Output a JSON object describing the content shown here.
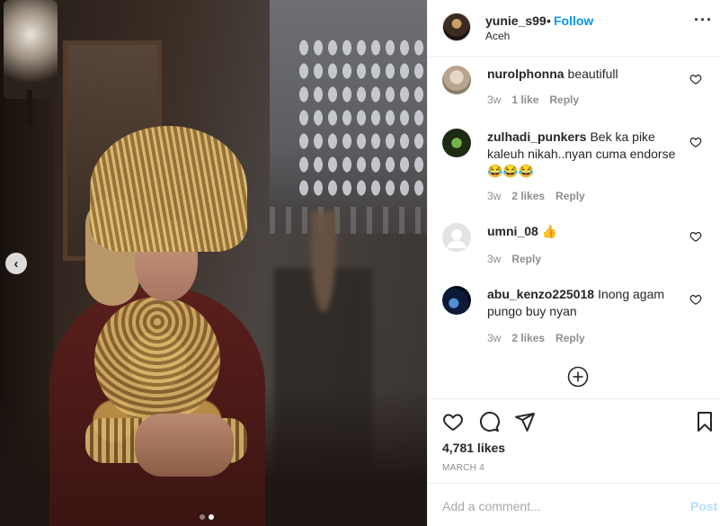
{
  "post": {
    "username": "yunie_s99",
    "separator": "•",
    "follow_label": "Follow",
    "location": "Aceh",
    "more_icon": "more-horizontal-icon"
  },
  "carousel": {
    "prev_glyph": "‹",
    "slide_count": 2,
    "active_slide": 2
  },
  "comments": [
    {
      "user": "nurolphonna",
      "text": "beautifull",
      "time": "3w",
      "likes": "1 like",
      "reply": "Reply"
    },
    {
      "user": "zulhadi_punkers",
      "text": "Bek ka pike kaleuh nikah..nyan cuma endorse 😂😂😂",
      "time": "3w",
      "likes": "2 likes",
      "reply": "Reply"
    },
    {
      "user": "umni_08",
      "text": "👍",
      "time": "3w",
      "likes": "",
      "reply": "Reply"
    },
    {
      "user": "abu_kenzo225018",
      "text": "Inong agam pungo buy nyan",
      "time": "3w",
      "likes": "2 likes",
      "reply": "Reply"
    }
  ],
  "actions": {
    "likes_count": "4,781 likes",
    "date": "MARCH 4"
  },
  "add_comment": {
    "placeholder": "Add a comment...",
    "post_label": "Post"
  },
  "colors": {
    "link": "#0095f6",
    "post_disabled": "#b2dffc",
    "meta": "#8e8e8e",
    "text": "#262626"
  }
}
